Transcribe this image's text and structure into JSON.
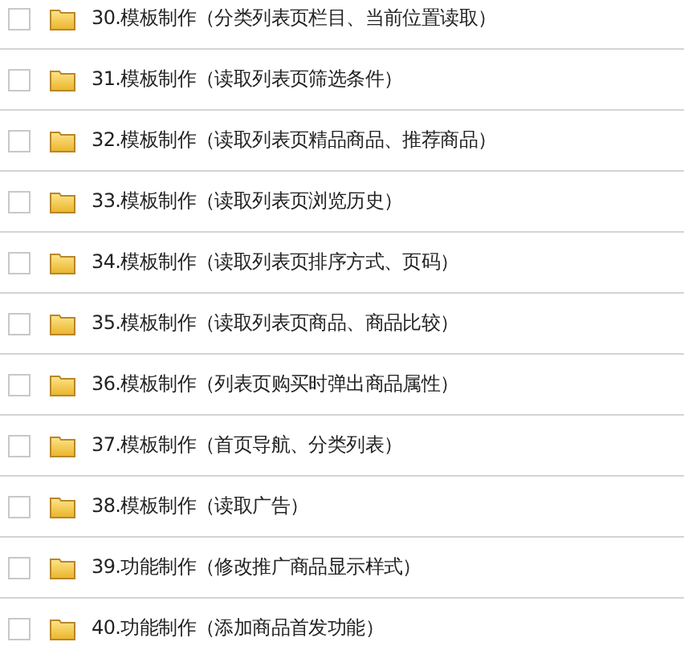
{
  "items": [
    {
      "label": "30.模板制作（分类列表页栏目、当前位置读取）",
      "checked": false
    },
    {
      "label": "31.模板制作（读取列表页筛选条件）",
      "checked": false
    },
    {
      "label": "32.模板制作（读取列表页精品商品、推荐商品）",
      "checked": false
    },
    {
      "label": "33.模板制作（读取列表页浏览历史）",
      "checked": false
    },
    {
      "label": "34.模板制作（读取列表页排序方式、页码）",
      "checked": false
    },
    {
      "label": "35.模板制作（读取列表页商品、商品比较）",
      "checked": false
    },
    {
      "label": "36.模板制作（列表页购买时弹出商品属性）",
      "checked": false
    },
    {
      "label": "37.模板制作（首页导航、分类列表）",
      "checked": false
    },
    {
      "label": "38.模板制作（读取广告）",
      "checked": false
    },
    {
      "label": "39.功能制作（修改推广商品显示样式）",
      "checked": false
    },
    {
      "label": "40.功能制作（添加商品首发功能）",
      "checked": false
    }
  ]
}
